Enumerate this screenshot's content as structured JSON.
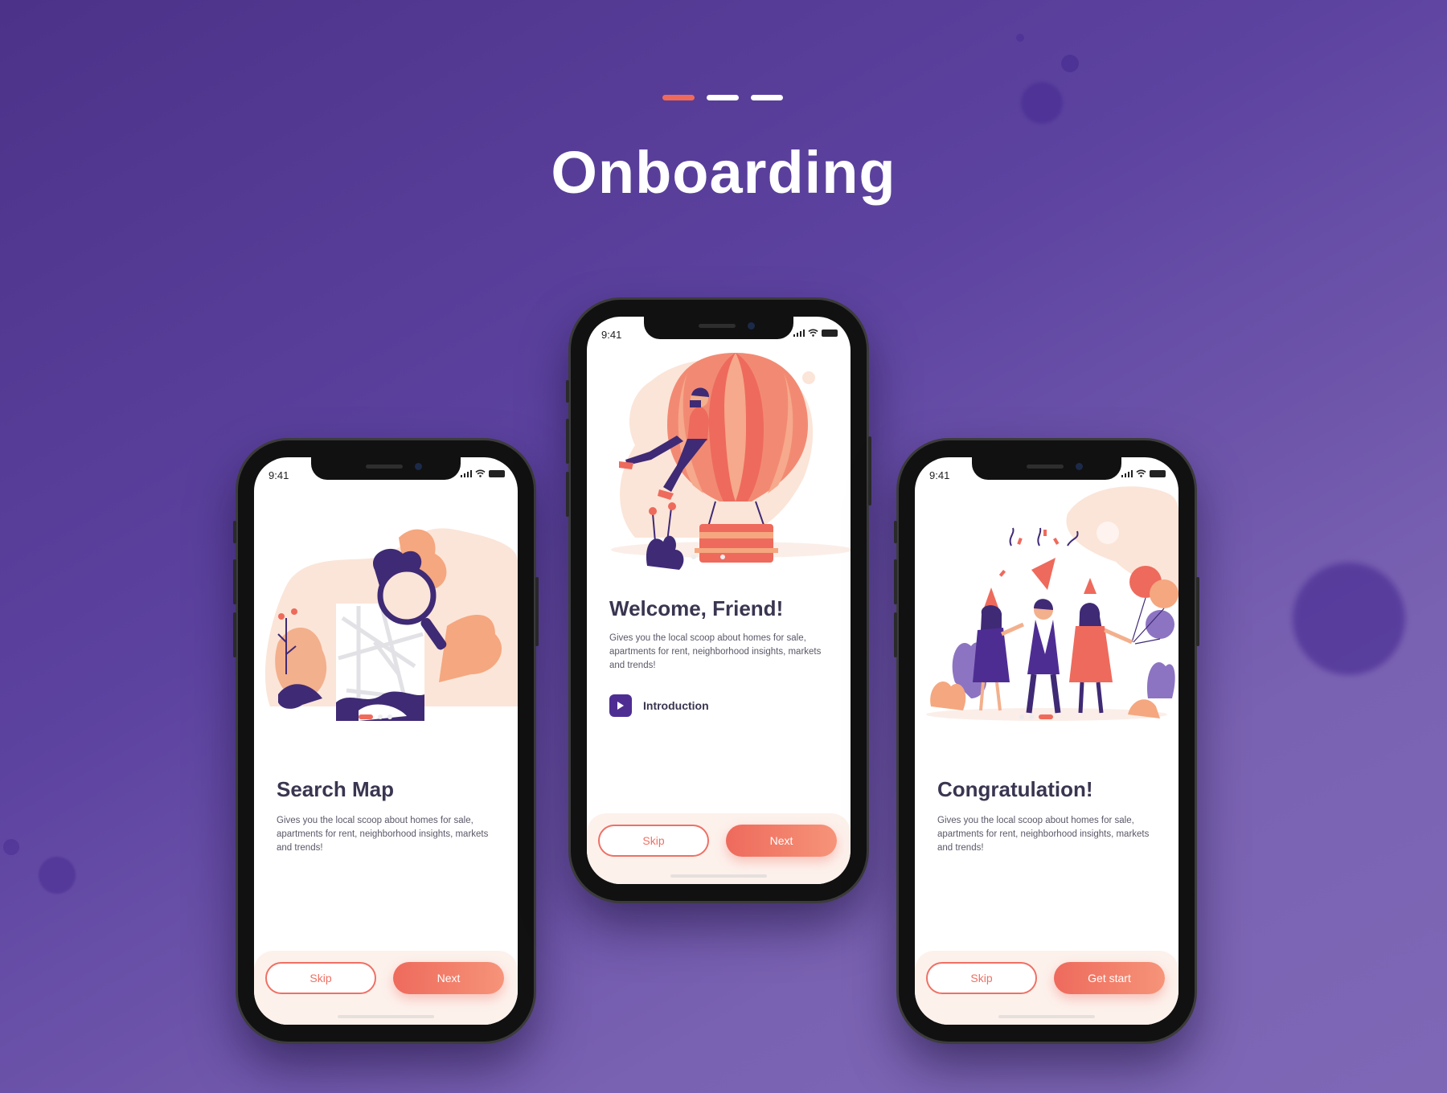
{
  "header": {
    "title": "Onboarding",
    "progress_segments": 3,
    "active_segment": 1
  },
  "colors": {
    "background": "#5a3f9e",
    "accent": "#f06a5a",
    "primary_purple": "#4e2d93",
    "text_dark": "#3a3550"
  },
  "screens": [
    {
      "status_time": "9:41",
      "title": "Search Map",
      "description": "Gives you the local scoop about homes for sale, apartments for rent, neighborhood insights, markets and trends!",
      "skip_label": "Skip",
      "primary_label": "Next",
      "illustration": "search-map-illustration"
    },
    {
      "status_time": "9:41",
      "title": "Welcome, Friend!",
      "description": "Gives you the local scoop about homes for sale, apartments for rent, neighborhood insights, markets and trends!",
      "intro_label": "Introduction",
      "skip_label": "Skip",
      "primary_label": "Next",
      "illustration": "hot-air-balloon-illustration"
    },
    {
      "status_time": "9:41",
      "title": "Congratulation!",
      "description": "Gives you the local scoop about homes for sale, apartments for rent, neighborhood insights, markets and trends!",
      "skip_label": "Skip",
      "primary_label": "Get start",
      "illustration": "celebration-illustration"
    }
  ]
}
